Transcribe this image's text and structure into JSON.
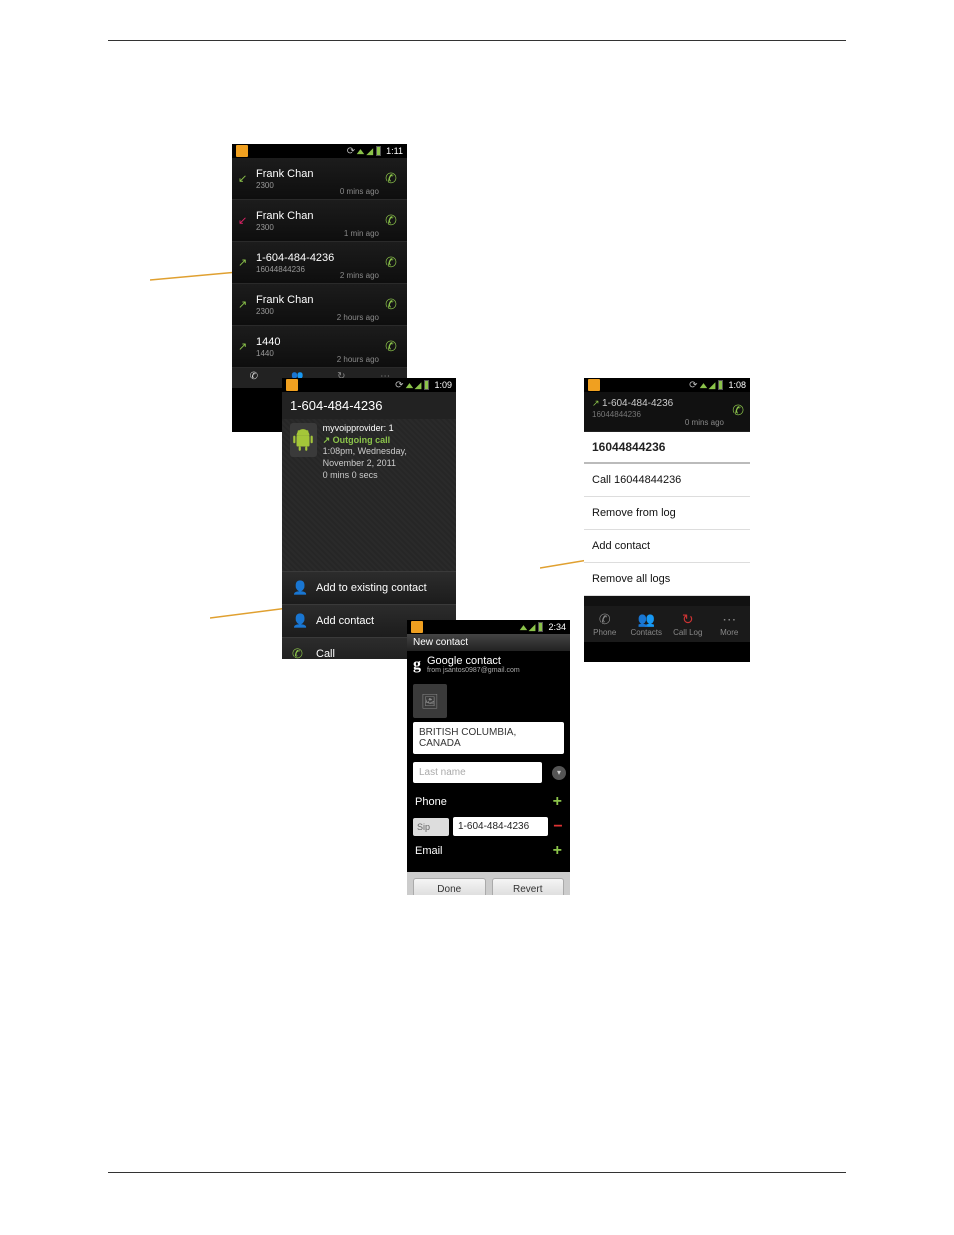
{
  "phone1": {
    "status_time": "1:11",
    "rows": [
      {
        "icon_type": "incoming",
        "name": "Frank Chan",
        "sub": "2300",
        "ago": "0 mins ago"
      },
      {
        "icon_type": "missed",
        "name": "Frank Chan",
        "sub": "2300",
        "ago": "1 min ago"
      },
      {
        "icon_type": "outgoing",
        "name": "1-604-484-4236",
        "sub": "16044844236",
        "ago": "2 mins ago"
      },
      {
        "icon_type": "outgoing",
        "name": "Frank Chan",
        "sub": "2300",
        "ago": "2 hours ago"
      },
      {
        "icon_type": "outgoing",
        "name": "1440",
        "sub": "1440",
        "ago": "2 hours ago"
      }
    ]
  },
  "phone2": {
    "status_time": "1:09",
    "number": "1-604-484-4236",
    "provider": "myvoipprovider: 1",
    "call_type": "Outgoing call",
    "timestamp": "1:08pm, Wednesday, November 2, 2011",
    "duration": "0 mins 0 secs",
    "action_add_existing": "Add to existing contact",
    "action_add_contact": "Add contact",
    "action_call": "Call"
  },
  "phone3": {
    "status_time": "1:08",
    "row_number": "1-604-484-4236",
    "row_sub": "16044844236",
    "row_ago": "0 mins ago",
    "popup_title": "16044844236",
    "popup_items": [
      "Call 16044844236",
      "Remove from log",
      "Add contact",
      "Remove all logs"
    ],
    "tabs": [
      "Phone",
      "Contacts",
      "Call Log",
      "More"
    ]
  },
  "phone4": {
    "status_time": "2:34",
    "screen_title": "New contact",
    "google_contact": "Google contact",
    "google_from": "from jsantos0987@gmail.com",
    "first_name_value": "BRITISH COLUMBIA, CANADA",
    "last_name_placeholder": "Last name",
    "section_phone": "Phone",
    "phone_type": "Sip",
    "phone_value": "1-604-484-4236",
    "section_email": "Email",
    "btn_done": "Done",
    "btn_revert": "Revert"
  }
}
